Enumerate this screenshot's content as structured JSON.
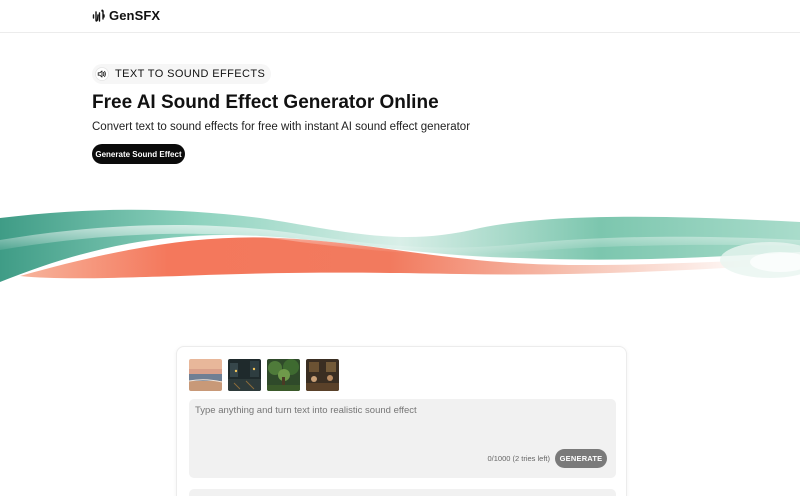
{
  "header": {
    "brand_name": "GenSFX",
    "brand_icon": "waveform-icon"
  },
  "hero": {
    "tag_icon": "speaker-icon",
    "tag_label": "TEXT TO SOUND EFFECTS",
    "title": "Free AI Sound Effect Generator Online",
    "subtitle": "Convert text to sound effects for free with instant AI sound effect generator",
    "cta_label": "Generate Sound Effect"
  },
  "generator": {
    "thumbnails": [
      {
        "icon": "beach-sunset-thumbnail"
      },
      {
        "icon": "rainy-city-night-thumbnail"
      },
      {
        "icon": "forest-thumbnail"
      },
      {
        "icon": "cafe-interior-thumbnail"
      }
    ],
    "prompt_placeholder": "Type anything and turn text into realistic sound effect",
    "prompt_value": "",
    "counter": "0/1000 (2 tries left)",
    "generate_label": "GENERATE"
  },
  "colors": {
    "cta_bg": "#0b0b0b",
    "generate_bg": "#7a7a7a",
    "wave_teal": "#5fb39a",
    "wave_coral": "#f4785c",
    "field_bg": "#f1f1f1"
  }
}
